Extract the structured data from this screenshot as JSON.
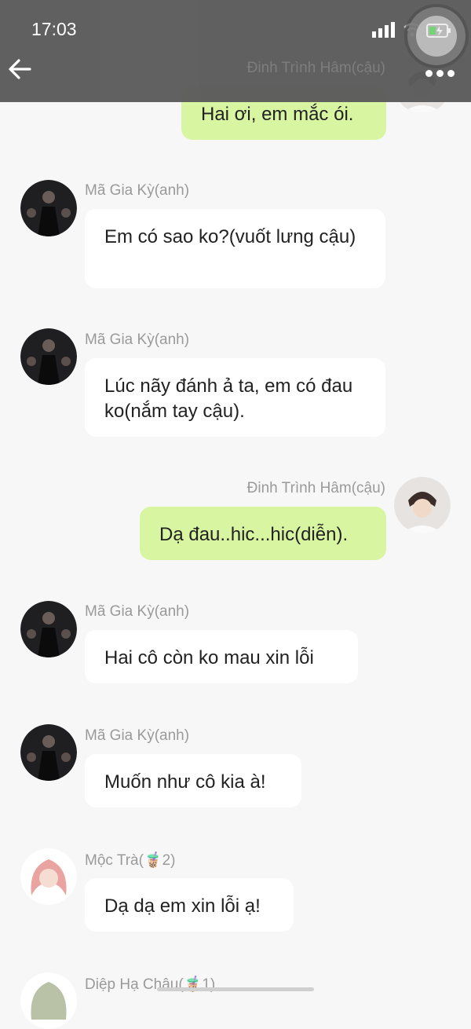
{
  "status_bar": {
    "time": "17:03"
  },
  "header": {
    "title": "Đinh Trình Hâm(cậu)"
  },
  "messages": [
    {
      "sender": "Đinh Trình Hâm(cậu)",
      "text": "Hai ơi, em mắc ói.",
      "side": "right"
    },
    {
      "sender": "Mã Gia Kỳ(anh)",
      "text": "Em có sao ko?(vuốt lưng cậu)",
      "side": "left"
    },
    {
      "sender": "Mã Gia Kỳ(anh)",
      "text": "Lúc nãy đánh ả ta, em có đau ko(nắm tay cậu).",
      "side": "left"
    },
    {
      "sender": "Đinh Trình Hâm(cậu)",
      "text": "Dạ đau..hic...hic(diễn).",
      "side": "right"
    },
    {
      "sender": "Mã Gia Kỳ(anh)",
      "text": "Hai cô còn ko mau xin lỗi",
      "side": "left"
    },
    {
      "sender": "Mã Gia Kỳ(anh)",
      "text": "Muốn như cô kia à!",
      "side": "left"
    },
    {
      "sender": "Mộc Trà(🧋2)",
      "text": "Dạ dạ em xin lỗi ạ!",
      "side": "left"
    },
    {
      "sender": "Diệp Hạ Châu(🧋1)",
      "text": "",
      "side": "left"
    }
  ],
  "colors": {
    "bubble_out": "#d8f5a2",
    "bubble_in": "#ffffff",
    "background": "#f7f7f7",
    "topbar": "#5c5c5c"
  },
  "icons": [
    "back-arrow-icon",
    "more-icon",
    "signal-icon",
    "wifi-icon",
    "battery-icon"
  ]
}
